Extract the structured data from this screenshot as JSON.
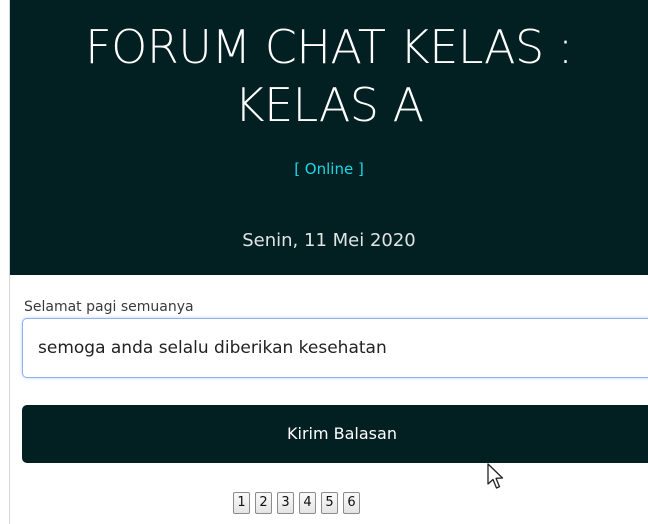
{
  "header": {
    "title_line1": "FORUM CHAT KELAS :",
    "title_line2": "KELAS A",
    "status": "[ Online ]",
    "date": "Senin, 11 Mei 2020"
  },
  "chat": {
    "previous_message": "Selamat pagi semuanya",
    "reply_value": "semoga anda selalu diberikan kesehatan",
    "submit_label": "Kirim Balasan"
  },
  "pagination": {
    "pages": [
      "1",
      "2",
      "3",
      "4",
      "5",
      "6"
    ]
  },
  "colors": {
    "header_bg": "#021f22",
    "status_text": "#19d8e6",
    "button_bg": "#021f22"
  },
  "icons": {
    "cursor": "mouse-pointer-icon"
  }
}
